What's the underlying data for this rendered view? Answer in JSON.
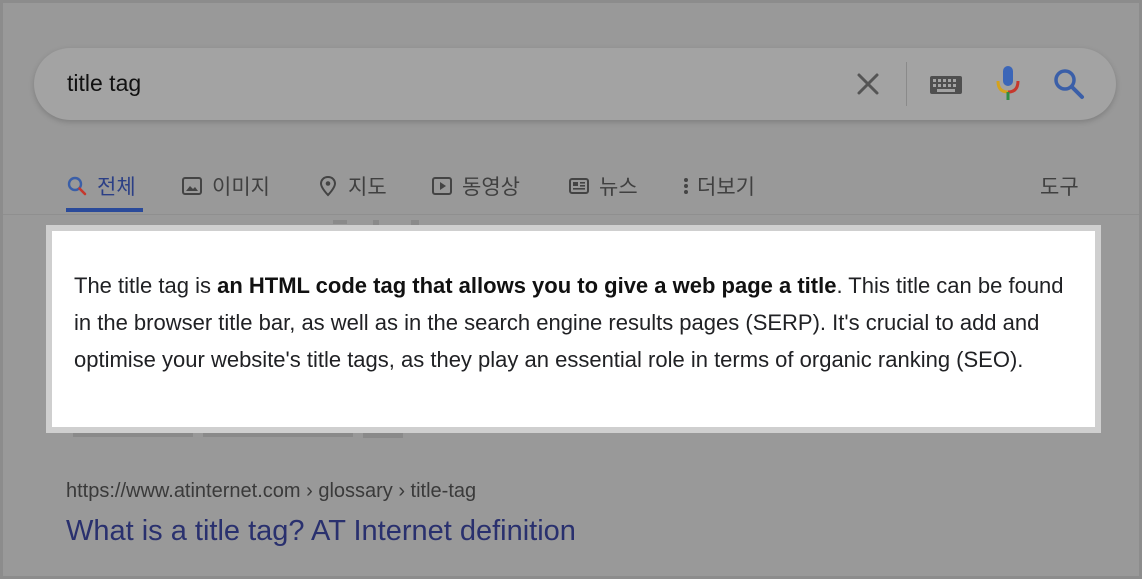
{
  "search": {
    "query": "title tag"
  },
  "tabs": [
    {
      "label": "전체",
      "icon": "search-icon",
      "active": true
    },
    {
      "label": "이미지",
      "icon": "image-icon"
    },
    {
      "label": "지도",
      "icon": "map-pin-icon"
    },
    {
      "label": "동영상",
      "icon": "video-icon"
    },
    {
      "label": "뉴스",
      "icon": "news-icon"
    },
    {
      "label": "더보기",
      "icon": "more-vertical-icon"
    },
    {
      "label": "도구"
    }
  ],
  "snippet": {
    "text_before": "The title tag is ",
    "text_bold": "an HTML code tag that allows you to give a web page a title",
    "text_after": ". This title can be found in the browser title bar, as well as in the search engine results pages (SERP). It's crucial to add and optimise your website's title tags, as they play an essential role in terms of organic ranking (SEO)."
  },
  "result": {
    "url": "https://www.atinternet.com › glossary › title-tag",
    "title": "What is a title tag? AT Internet definition"
  },
  "colors": {
    "accent_tab": "#2b3f86",
    "link_title": "#29306e",
    "mic_red": "#c6382d",
    "mic_yellow": "#d4a21d",
    "mic_green": "#2f8d43",
    "mic_blue": "#3b66b8"
  }
}
